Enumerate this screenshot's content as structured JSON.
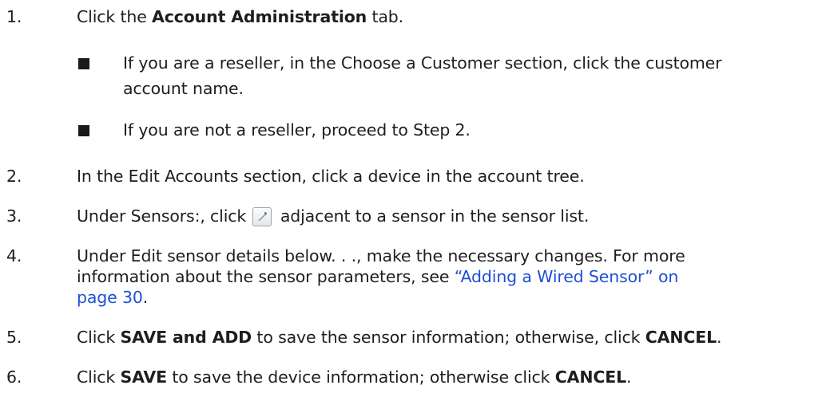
{
  "steps": [
    {
      "num": "1.",
      "pre": "Click the ",
      "bold": "Account Administration",
      "post": " tab."
    },
    {
      "num": "2.",
      "text": "In the Edit Accounts section, click a device in the account tree."
    },
    {
      "num": "3.",
      "pre": "Under Sensors:, click ",
      "post": " adjacent to a sensor in the sensor list."
    },
    {
      "num": "4.",
      "line1": "Under Edit sensor details below. . ., make the necessary changes. For more",
      "line2_pre": "information about the sensor parameters, see ",
      "link_part1": "“Adding a Wired Sensor” on",
      "link_part2": "page 30",
      "line3_post": "."
    },
    {
      "num": "5.",
      "pre": "Click ",
      "bold": "SAVE and ADD",
      "mid": " to save the sensor information; otherwise, click ",
      "bold2": "CANCEL",
      "post": "."
    },
    {
      "num": "6.",
      "pre": "Click ",
      "bold": "SAVE",
      "mid": " to save the device information; otherwise click ",
      "bold2": "CANCEL",
      "post": "."
    }
  ],
  "substeps": [
    {
      "line1": "If you are a reseller, in the Choose a Customer section, click the customer",
      "line2": "account name."
    },
    {
      "line1": "If you are not a reseller, proceed to Step 2."
    }
  ],
  "icons": {
    "edit": "wrench-icon"
  }
}
